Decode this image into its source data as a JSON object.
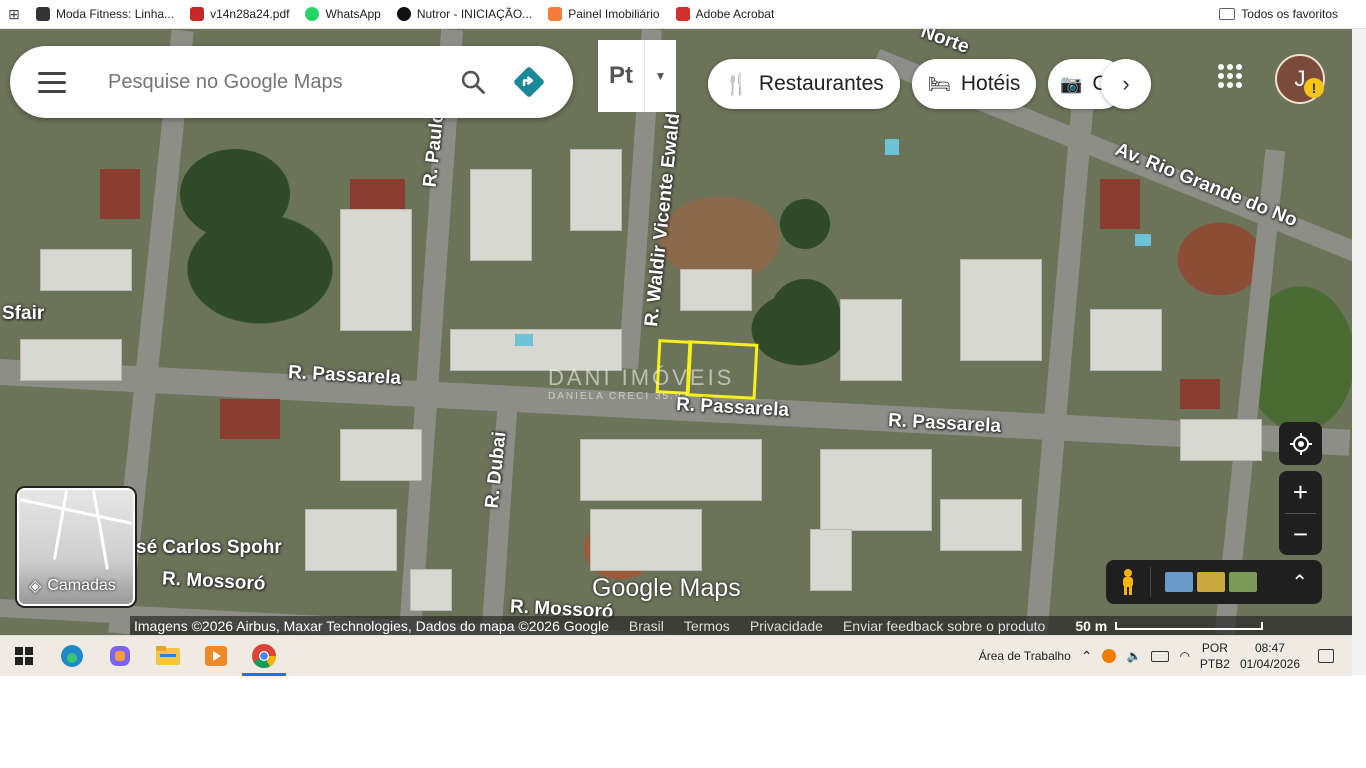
{
  "bookmarks": {
    "items": [
      {
        "label": "Moda Fitness: Linha..."
      },
      {
        "label": "v14n28a24.pdf"
      },
      {
        "label": "WhatsApp"
      },
      {
        "label": "Nutror - INICIAÇÃO..."
      },
      {
        "label": "Painel Imobiliário"
      },
      {
        "label": "Adobe Acrobat"
      }
    ],
    "all_bookmarks": "Todos os favoritos"
  },
  "search": {
    "placeholder": "Pesquise no Google Maps"
  },
  "pt_label": "Pt",
  "chips": {
    "restaurants": "Restaurantes",
    "hotels": "Hotéis",
    "more": "C"
  },
  "avatar": {
    "initial": "J",
    "warning": "!"
  },
  "streets": {
    "norte": "Norte",
    "rio_grande": "Av. Rio Grande do No",
    "paulo": "R. Paulo C",
    "waldir": "R. Waldir Vicente Ewald",
    "sfair": "Sfair",
    "passarela_1": "R. Passarela",
    "passarela_2": "R. Passarela",
    "passarela_3": "R. Passarela",
    "dubai": "R. Dubai",
    "jose": "sé Carlos Spohr",
    "mossoro_1": "R. Mossoró",
    "mossoro_2": "R. Mossoró"
  },
  "watermark": {
    "main": "DANI  IMÓVEIS",
    "sub": "DANIELA  CRECI 35.92"
  },
  "layers_label": "Camadas",
  "map_brand": "Google Maps",
  "footer": {
    "imagery": "Imagens ©2026 Airbus, Maxar Technologies, Dados do mapa ©2026 Google",
    "country": "Brasil",
    "terms": "Termos",
    "privacy": "Privacidade",
    "feedback": "Enviar feedback sobre o produto",
    "scale": "50 m"
  },
  "taskbar": {
    "desktop": "Área de Trabalho",
    "lang_1": "POR",
    "lang_2": "PTB2",
    "time": "08:47",
    "date": "01/04/2026"
  },
  "colors": {
    "highlight": "#f7f01a",
    "directions": "#1a8a9a",
    "taskbar_bg": "#f0ebe2"
  }
}
